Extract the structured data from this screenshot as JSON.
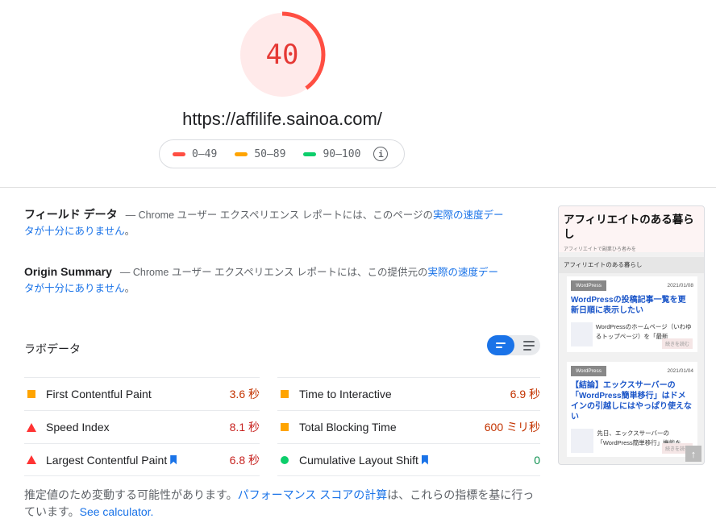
{
  "score": {
    "value": "40",
    "ring_fraction": 0.4,
    "color": "#ff4e42",
    "bg_color": "#ffeaea"
  },
  "url": "https://affilife.sainoa.com/",
  "legend": {
    "ranges": [
      {
        "label": "0–49",
        "color": "#ff4e42"
      },
      {
        "label": "50–89",
        "color": "#ffa400"
      },
      {
        "label": "90–100",
        "color": "#0cce6b"
      }
    ],
    "info_icon": "info-icon"
  },
  "field_data": {
    "heading": "フィールド データ",
    "dash": "—",
    "text_before": " Chrome ユーザー エクスペリエンス レポートには、このページの",
    "link": "実際の速度データが十分にありません",
    "text_after": "。"
  },
  "origin_summary": {
    "heading": "Origin Summary",
    "dash": "—",
    "text_before": " Chrome ユーザー エクスペリエンス レポートには、この提供元の",
    "link": "実際の速度データが十分にありません",
    "text_after": "。"
  },
  "lab": {
    "title": "ラボデータ",
    "metrics": [
      {
        "name": "First Contentful Paint",
        "value": "3.6 秒",
        "status": "average",
        "icon": "orange-square-icon",
        "bookmark": false
      },
      {
        "name": "Time to Interactive",
        "value": "6.9 秒",
        "status": "average",
        "icon": "orange-square-icon",
        "bookmark": false
      },
      {
        "name": "Speed Index",
        "value": "8.1 秒",
        "status": "fail",
        "icon": "red-triangle-icon",
        "bookmark": false
      },
      {
        "name": "Total Blocking Time",
        "value": "600 ミリ秒",
        "status": "average",
        "icon": "orange-square-icon",
        "bookmark": false
      },
      {
        "name": "Largest Contentful Paint",
        "value": "6.8 秒",
        "status": "fail",
        "icon": "red-triangle-icon",
        "bookmark": true
      },
      {
        "name": "Cumulative Layout Shift",
        "value": "0",
        "status": "pass",
        "icon": "green-circle-icon",
        "bookmark": true
      }
    ],
    "status_colors": {
      "pass": "#0d904f",
      "average": "#c33300",
      "fail": "#c7221f"
    }
  },
  "footnote": {
    "text_before": "推定値のため変動する可能性があります。",
    "link1": "パフォーマンス スコアの計算",
    "text_middle": "は、これらの指標を基に行っています。",
    "link2": "See calculator."
  },
  "screenshot": {
    "site_title": "アフィリエイトのある暮らし",
    "tagline": "アフィリエイトで副業ひろ者みを",
    "section": "アフィリエイトのある暮らし",
    "cards": [
      {
        "tag": "WordPress",
        "date": "2021/01/08",
        "title": "WordPressの投稿記事一覧を更新日順に表示したい",
        "excerpt": "WordPressのホームページ（いわゆるトップページ）を「最新",
        "more": "続きを読む"
      },
      {
        "tag": "WordPress",
        "date": "2021/01/04",
        "title": "【結論】エックスサーバーの「WordPress簡単移行」はドメインの引越しにはやっぱり使えない",
        "excerpt": "先日、エックスサーバーの「WordPress簡単移行」機能を",
        "more": "続きを読む"
      }
    ]
  }
}
